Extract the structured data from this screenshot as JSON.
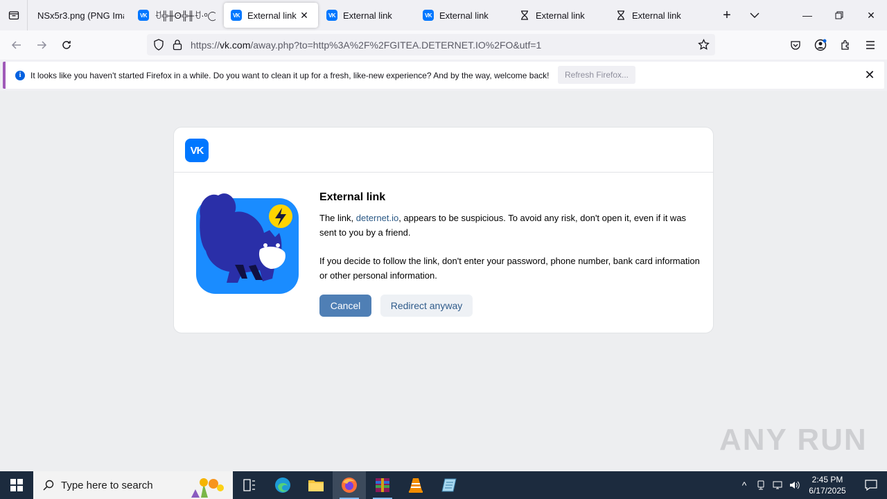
{
  "tabs": [
    {
      "label": "NSx5r3.png (PNG Imag",
      "icon": "none",
      "active": false
    },
    {
      "label": "ꀀ╬╫ʘ╬╫ꀀ·ᵒ◯·ᶜ",
      "icon": "vk-icon",
      "active": false
    },
    {
      "label": "External link",
      "icon": "vk-icon",
      "active": true
    },
    {
      "label": "External link",
      "icon": "vk-icon",
      "active": false
    },
    {
      "label": "External link",
      "icon": "vk-icon",
      "active": false
    },
    {
      "label": "External link",
      "icon": "hourglass-icon",
      "active": false
    },
    {
      "label": "External link",
      "icon": "hourglass-icon",
      "active": false
    }
  ],
  "urlbar": {
    "prefix": "https://",
    "host": "vk.com",
    "path": "/away.php?to=http%3A%2F%2FGITEA.DETERNET.IO%2FO&utf=1"
  },
  "notification": {
    "message": "It looks like you haven't started Firefox in a while. Do you want to clean it up for a fresh, like-new experience? And by the way, welcome back!",
    "button": "Refresh Firefox..."
  },
  "dialog": {
    "logo": "VK",
    "title": "External link",
    "p1_before": "The link, ",
    "p1_link": "deternet.io",
    "p1_after": ", appears to be suspicious. To avoid any risk, don't open it, even if it was sent to you by a friend.",
    "p2": "If you decide to follow the link, don't enter your password, phone number, bank card information or other personal information.",
    "cancel": "Cancel",
    "redirect": "Redirect anyway"
  },
  "watermark": "ANY RUN",
  "taskbar": {
    "search_placeholder": "Type here to search",
    "time": "2:45 PM",
    "date": "6/17/2025"
  },
  "colors": {
    "vk_blue": "#0077ff",
    "primary_button": "#4f7fb5",
    "link": "#2a5885",
    "taskbar": "#1c2b3e"
  }
}
